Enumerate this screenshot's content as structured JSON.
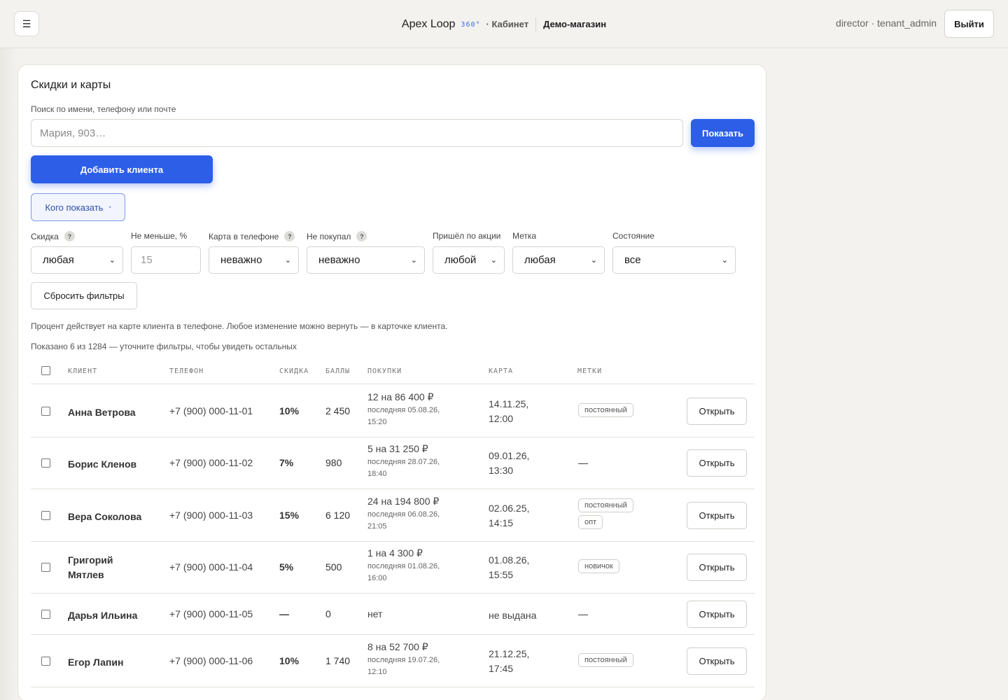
{
  "header": {
    "menu_icon": "☰",
    "brand_name": "Apex Loop",
    "brand_360": "360°",
    "section": "· Кабинет",
    "shop": "Демо-магазин",
    "user": "director · tenant_admin",
    "logout_label": "Выйти"
  },
  "page": {
    "title": "Скидки и карты",
    "search_label": "Поиск по имени, телефону или почте",
    "search_placeholder": "Мария, 903…",
    "search_value": "",
    "show_label": "Показать",
    "add_label": "Добавить клиента",
    "who_label": "Кого показать",
    "who_dot": "•"
  },
  "filters": {
    "discount": {
      "label": "Скидка",
      "value": "любая"
    },
    "min_percent": {
      "label": "Не меньше, %",
      "placeholder": "15"
    },
    "card_in_phone": {
      "label": "Карта в телефоне",
      "value": "неважно"
    },
    "not_bought": {
      "label": "Не покупал",
      "value": "неважно"
    },
    "by_promo": {
      "label": "Пришёл по акции",
      "value": "любой"
    },
    "tag": {
      "label": "Метка",
      "value": "любая"
    },
    "state": {
      "label": "Состояние",
      "value": "все"
    },
    "help_mark": "?",
    "reset_label": "Сбросить фильтры"
  },
  "hint": "Процент действует на карте клиента в телефоне. Любое изменение можно вернуть — в карточке клиента.",
  "shown_info": "Показано 6 из 1284 — уточните фильтры, чтобы увидеть остальных",
  "table": {
    "columns": [
      "КЛИЕНТ",
      "ТЕЛЕФОН",
      "СКИДКА",
      "БАЛЛЫ",
      "ПОКУПКИ",
      "КАРТА",
      "МЕТКИ"
    ],
    "open_label": "Открыть",
    "rows": [
      {
        "name_1": "Анна Ветрова",
        "name_2": "",
        "phone": "+7 (900) 000-11-01",
        "discount": "10%",
        "points": "2 450",
        "buy": "12 на 86 400 ₽",
        "buy_sub_1": "последняя 05.08.26,",
        "buy_sub_2": "15:20",
        "card_1": "14.11.25,",
        "card_2": "12:00",
        "tags": [
          "постоянный"
        ],
        "no_tags": ""
      },
      {
        "name_1": "Борис Кленов",
        "name_2": "",
        "phone": "+7 (900) 000-11-02",
        "discount": "7%",
        "points": "980",
        "buy": "5 на 31 250 ₽",
        "buy_sub_1": "последняя 28.07.26,",
        "buy_sub_2": "18:40",
        "card_1": "09.01.26,",
        "card_2": "13:30",
        "tags": [],
        "no_tags": "—"
      },
      {
        "name_1": "Вера Соколова",
        "name_2": "",
        "phone": "+7 (900) 000-11-03",
        "discount": "15%",
        "points": "6 120",
        "buy": "24 на 194 800 ₽",
        "buy_sub_1": "последняя 06.08.26,",
        "buy_sub_2": "21:05",
        "card_1": "02.06.25,",
        "card_2": "14:15",
        "tags": [
          "постоянный",
          "опт"
        ],
        "no_tags": ""
      },
      {
        "name_1": "Григорий",
        "name_2": "Мятлев",
        "phone": "+7 (900) 000-11-04",
        "discount": "5%",
        "points": "500",
        "buy": "1 на 4 300 ₽",
        "buy_sub_1": "последняя 01.08.26,",
        "buy_sub_2": "16:00",
        "card_1": "01.08.26,",
        "card_2": "15:55",
        "tags": [
          "новичок"
        ],
        "no_tags": ""
      },
      {
        "name_1": "Дарья Ильина",
        "name_2": "",
        "phone": "+7 (900) 000-11-05",
        "discount": "—",
        "points": "0",
        "buy": "нет",
        "buy_sub_1": "",
        "buy_sub_2": "",
        "card_1": "не выдана",
        "card_2": "",
        "tags": [],
        "no_tags": "—"
      },
      {
        "name_1": "Егор Лапин",
        "name_2": "",
        "phone": "+7 (900) 000-11-06",
        "discount": "10%",
        "points": "1 740",
        "buy": "8 на 52 700 ₽",
        "buy_sub_1": "последняя 19.07.26,",
        "buy_sub_2": "12:10",
        "card_1": "21.12.25,",
        "card_2": "17:45",
        "tags": [
          "постоянный"
        ],
        "no_tags": ""
      }
    ]
  },
  "colors": {
    "accent": "#2c5ee8",
    "background": "#f3f2ee"
  },
  "icons": {
    "menu": "hamburger-icon",
    "help": "help-icon",
    "chevron": "chevron-down-icon"
  }
}
